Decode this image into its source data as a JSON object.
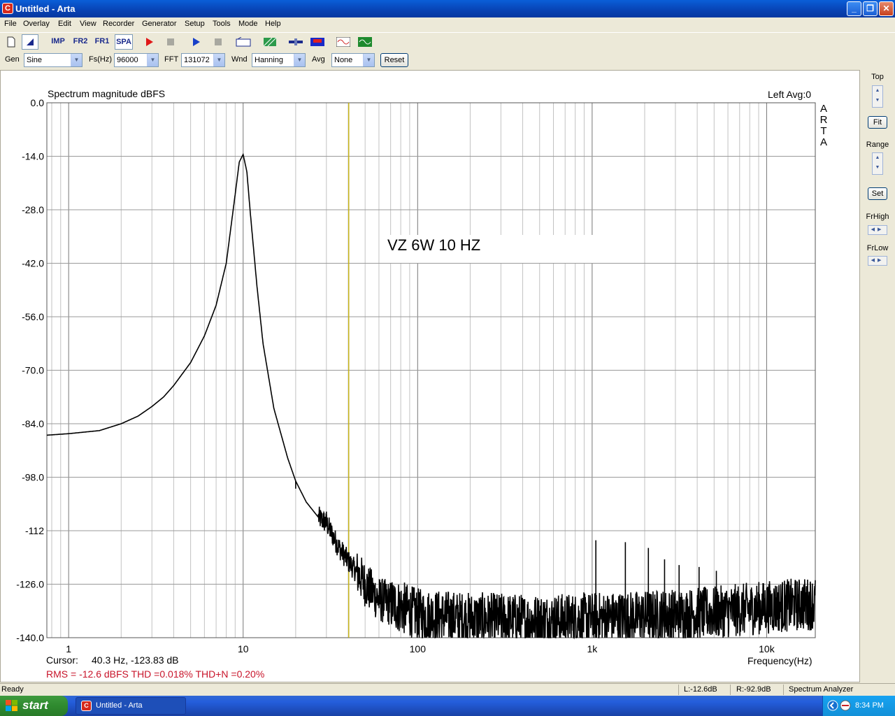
{
  "window": {
    "title": "Untitled - Arta",
    "icon": "arta-logo-icon"
  },
  "menu": [
    "File",
    "Overlay",
    "Edit",
    "View",
    "Recorder",
    "Generator",
    "Setup",
    "Tools",
    "Mode",
    "Help"
  ],
  "toolbar": {
    "imp_label": "IMP",
    "fr2_label": "FR2",
    "fr1_label": "FR1",
    "spa_label": "SPA"
  },
  "options": {
    "gen_label": "Gen",
    "gen_value": "Sine",
    "fs_label": "Fs(Hz)",
    "fs_value": "96000",
    "fft_label": "FFT",
    "fft_value": "131072",
    "wnd_label": "Wnd",
    "wnd_value": "Hanning",
    "avg_label": "Avg",
    "avg_value": "None",
    "reset_label": "Reset"
  },
  "plot": {
    "title": "Spectrum magnitude dBFS",
    "channel_info": "Left  Avg:0",
    "watermark": [
      "A",
      "R",
      "T",
      "A"
    ],
    "annotation": "VZ 6W 10 HZ",
    "xlabel": "Frequency(Hz)",
    "cursor_label": "Cursor:",
    "cursor_value": "40.3 Hz, -123.83 dB",
    "stats": "RMS =  -12.6 dBFS    THD =0.018%    THD+N =0.20%"
  },
  "chart_data": {
    "type": "line",
    "title": "Spectrum magnitude dBFS",
    "xlabel": "Frequency(Hz)",
    "ylabel": "",
    "x_scale": "log",
    "xlim": [
      0.75,
      19000
    ],
    "ylim": [
      -140,
      0
    ],
    "grid": true,
    "yticks": [
      0.0,
      -14.0,
      -28.0,
      -42.0,
      -56.0,
      -70.0,
      -84.0,
      -98.0,
      -112,
      -126.0,
      -140.0
    ],
    "ytick_labels": [
      "0.0",
      "-14.0",
      "-28.0",
      "-42.0",
      "-56.0",
      "-70.0",
      "-84.0",
      "-98.0",
      "-112",
      "-126.0",
      "-140.0"
    ],
    "xticks": [
      1,
      10,
      100,
      1000,
      10000
    ],
    "xtick_labels": [
      "1",
      "10",
      "100",
      "1k",
      "10k"
    ],
    "cursor_frequency_hz": 40.3,
    "series": [
      {
        "color": "#000000",
        "x": [
          0.75,
          1.0,
          1.5,
          2.0,
          2.5,
          3.0,
          3.5,
          4.0,
          5.0,
          6.0,
          7.0,
          8.0,
          9.0,
          9.5,
          10.0,
          10.5,
          11.0,
          12.0,
          13.0,
          15.0,
          18.0,
          20.0,
          23.0,
          27.0,
          30.0,
          35.0,
          40.0,
          45.0,
          50.0,
          60.0,
          80.0,
          100.0,
          200.0,
          500.0,
          1000.0,
          2000.0,
          5000.0,
          10000.0,
          19000.0
        ],
        "y": [
          -87.0,
          -86.6,
          -85.8,
          -84.0,
          -82.0,
          -79.5,
          -77.0,
          -74.0,
          -68.0,
          -61.0,
          -53.0,
          -42.0,
          -24.0,
          -15.5,
          -13.5,
          -18.0,
          -29.0,
          -48.0,
          -63.0,
          -80.0,
          -93.0,
          -99.0,
          -104.5,
          -108.5,
          -110.0,
          -116.0,
          -120.0,
          -123.0,
          -126.0,
          -130.0,
          -132.0,
          -134.0,
          -135.0,
          -135.5,
          -135.0,
          -134.5,
          -133.5,
          -132.0,
          -131.0
        ]
      }
    ],
    "spikes": [
      {
        "x": 20.0,
        "y": -101.0
      },
      {
        "x": 30.0,
        "y": -107.0
      },
      {
        "x": 1050.0,
        "y": -114.5
      },
      {
        "x": 1550.0,
        "y": -115.0
      },
      {
        "x": 2100.0,
        "y": -116.5
      },
      {
        "x": 2600.0,
        "y": -119.5
      },
      {
        "x": 3150.0,
        "y": -121.0
      },
      {
        "x": 4100.0,
        "y": -121.5
      },
      {
        "x": 5150.0,
        "y": -122.5
      }
    ]
  },
  "rightpanel": {
    "top_label": "Top",
    "fit_label": "Fit",
    "range_label": "Range",
    "set_label": "Set",
    "frhigh_label": "FrHigh",
    "frlow_label": "FrLow"
  },
  "status": {
    "ready": "Ready",
    "left_level": "L:-12.6dB",
    "right_level": "R:-92.9dB",
    "mode": "Spectrum Analyzer"
  },
  "taskbar": {
    "start_label": "start",
    "app_label": "Untitled - Arta",
    "clock": "8:34 PM"
  }
}
